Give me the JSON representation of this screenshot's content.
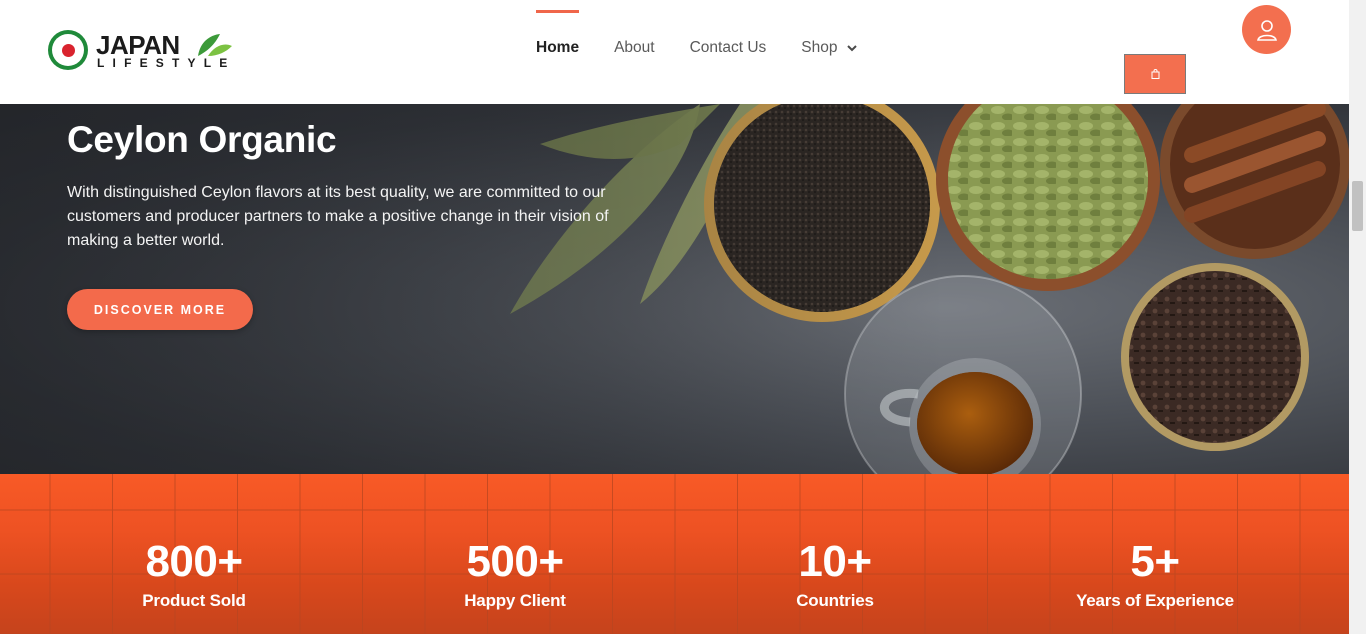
{
  "brand": {
    "name_top": "JAPAN",
    "name_bottom": "LIFESTYLE",
    "seal_text": "JAPAN LIFESTYLE"
  },
  "nav": {
    "items": [
      {
        "label": "Home",
        "active": true
      },
      {
        "label": "About",
        "active": false
      },
      {
        "label": "Contact Us",
        "active": false
      },
      {
        "label": "Shop",
        "active": false,
        "has_dropdown": true
      }
    ]
  },
  "header_actions": {
    "cart_icon": "shopping-bag-icon",
    "user_icon": "user-icon"
  },
  "hero": {
    "title": "Ceylon Organic",
    "description": "With distinguished Ceylon flavors at its best quality, we are committed to our customers and producer partners to make a positive change in their vision of making a better world.",
    "cta_label": "DISCOVER MORE"
  },
  "stats": [
    {
      "value": "800+",
      "label": "Product Sold"
    },
    {
      "value": "500+",
      "label": "Happy Client"
    },
    {
      "value": "10+",
      "label": "Countries"
    },
    {
      "value": "5+",
      "label": "Years of Experience"
    }
  ],
  "colors": {
    "accent": "#f36f4f",
    "stats_band": "#ee5223",
    "nav_active_bar": "#f0664a",
    "logo_green": "#1f8a3a",
    "logo_red": "#d9232e"
  }
}
